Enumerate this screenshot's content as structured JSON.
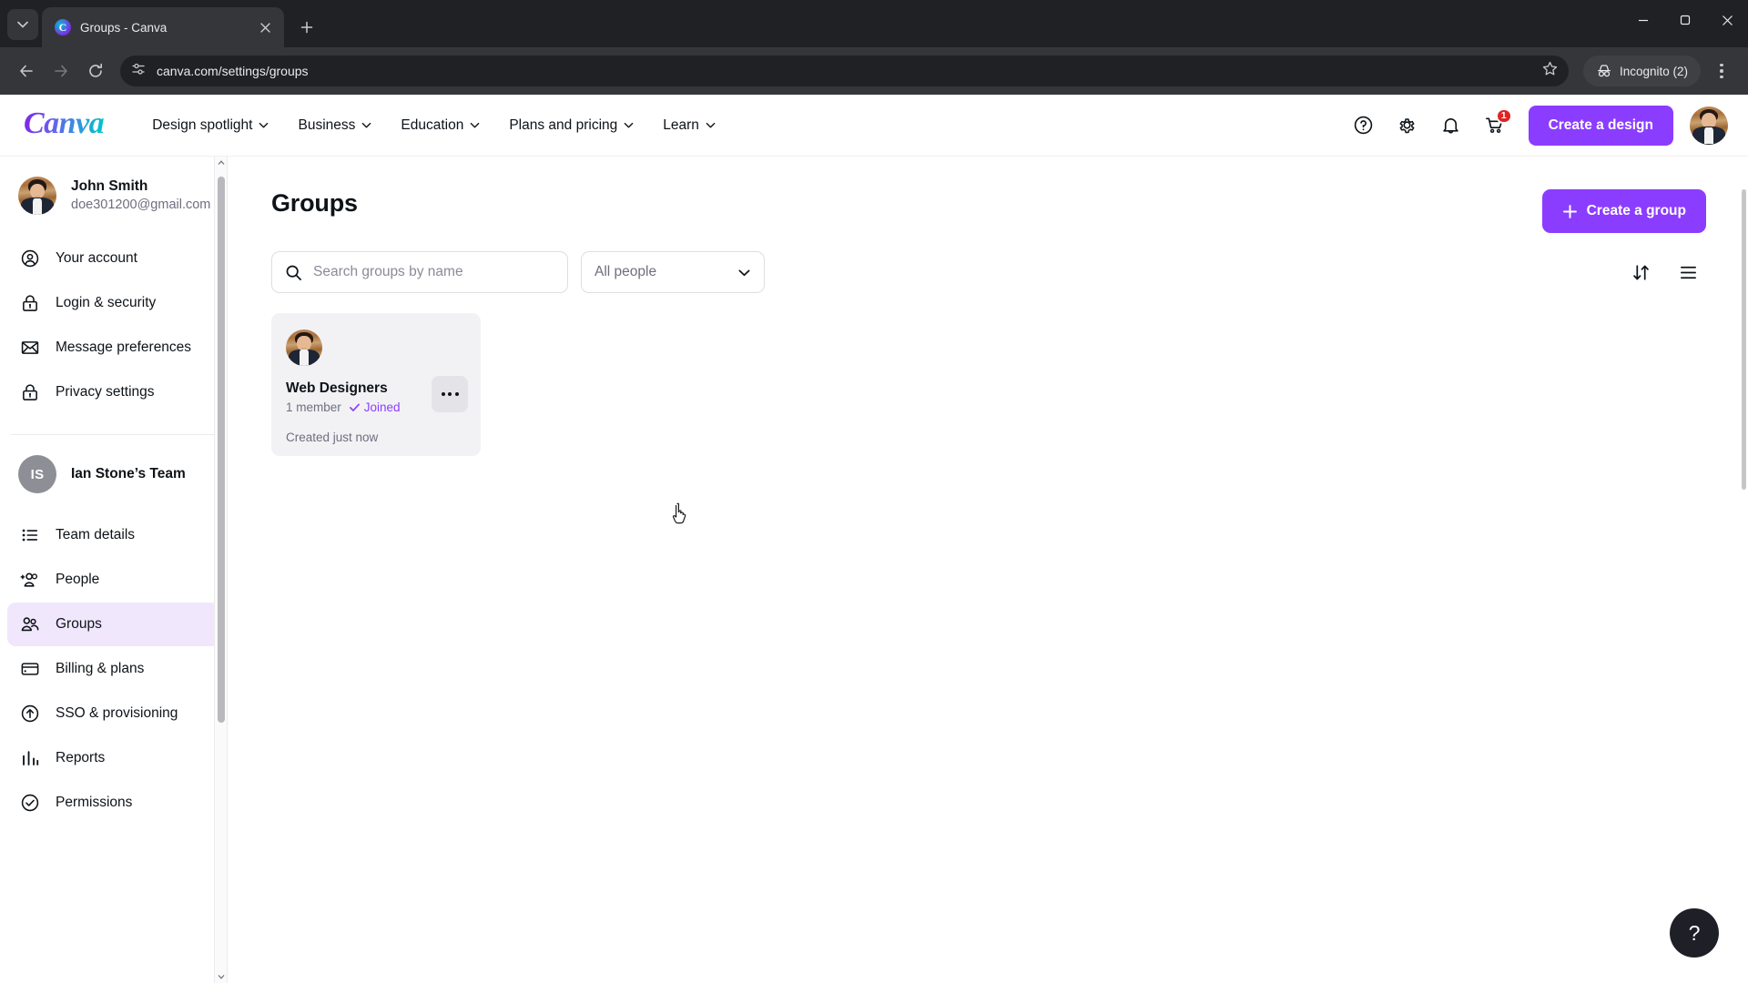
{
  "browser": {
    "tab": {
      "title": "Groups - Canva",
      "favicon": "canva-favicon"
    },
    "url": "canva.com/settings/groups",
    "profile_pill": "Incognito (2)",
    "new_tab_label": "+",
    "controls": {
      "back": "back-arrow",
      "forward": "forward-arrow",
      "reload": "reload",
      "bookmark": "star",
      "menu": "three-dot-menu",
      "minimize": "minimize",
      "maximize": "maximize",
      "close": "close"
    }
  },
  "header": {
    "logo": "Canva",
    "nav": [
      {
        "label": "Design spotlight",
        "has_chevron": true
      },
      {
        "label": "Business",
        "has_chevron": true
      },
      {
        "label": "Education",
        "has_chevron": true
      },
      {
        "label": "Plans and pricing",
        "has_chevron": true
      },
      {
        "label": "Learn",
        "has_chevron": true
      }
    ],
    "help_icon": "help-circle-icon",
    "settings_icon": "gear-icon",
    "notifications_icon": "bell-icon",
    "cart_icon": "cart-icon",
    "cart_badge": "1",
    "create_design_label": "Create a design",
    "avatar": "user-avatar"
  },
  "sidebar": {
    "profile": {
      "name": "John Smith",
      "email": "doe301200@gmail.com"
    },
    "personal_items": [
      {
        "label": "Your account",
        "icon": "person-circle-icon"
      },
      {
        "label": "Login & security",
        "icon": "lock-icon"
      },
      {
        "label": "Message preferences",
        "icon": "envelope-icon"
      },
      {
        "label": "Privacy settings",
        "icon": "lock-icon"
      }
    ],
    "team": {
      "initials": "IS",
      "name": "Ian Stone’s Team"
    },
    "team_items": [
      {
        "label": "Team details",
        "icon": "list-icon",
        "active": false
      },
      {
        "label": "People",
        "icon": "add-people-icon",
        "active": false
      },
      {
        "label": "Groups",
        "icon": "groups-icon",
        "active": true
      },
      {
        "label": "Billing & plans",
        "icon": "card-icon",
        "active": false
      },
      {
        "label": "SSO & provisioning",
        "icon": "upload-circle-icon",
        "active": false
      },
      {
        "label": "Reports",
        "icon": "bar-chart-icon",
        "active": false
      },
      {
        "label": "Permissions",
        "icon": "check-circle-icon",
        "active": false
      }
    ]
  },
  "main": {
    "title": "Groups",
    "create_group_label": "Create a group",
    "search": {
      "placeholder": "Search groups by name",
      "value": "",
      "icon": "search-icon"
    },
    "filter": {
      "value": "All people",
      "icon": "chevron-down-icon"
    },
    "sort_icon": "sort-icon",
    "view_icon": "list-view-icon",
    "groups": [
      {
        "name": "Web Designers",
        "members": "1 member",
        "status": "Joined",
        "created": "Created just now",
        "more_label": "more-options"
      }
    ],
    "help_fab": "?"
  },
  "colors": {
    "brand_purple": "#8b3dff",
    "active_nav_bg": "#f0e7fd",
    "card_bg": "#f2f2f4",
    "badge_red": "#e02424"
  }
}
